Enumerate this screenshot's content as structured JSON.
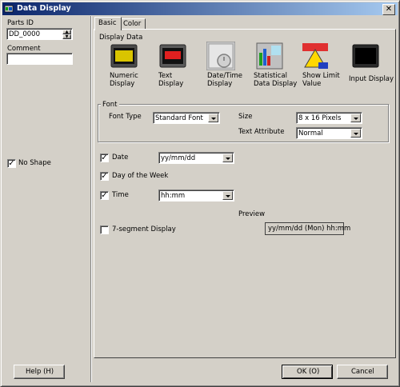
{
  "window": {
    "title": "Data Display",
    "close_glyph": "✕"
  },
  "left": {
    "parts_id_label": "Parts ID",
    "parts_id_value": "DD_0000",
    "comment_label": "Comment",
    "comment_value": "",
    "no_shape_label": "No Shape",
    "no_shape_checked": true
  },
  "tabs": [
    {
      "label": "Basic",
      "active": true
    },
    {
      "label": "Color",
      "active": false
    }
  ],
  "display_data": {
    "label": "Display Data",
    "options": [
      {
        "label_line1": "Numeric",
        "label_line2": "Display",
        "icon": "numeric-display-icon",
        "glyph": "123"
      },
      {
        "label_line1": "Text",
        "label_line2": "Display",
        "icon": "text-display-icon",
        "glyph": "abc"
      },
      {
        "label_line1": "Date/Time",
        "label_line2": "Display",
        "icon": "date-time-display-icon",
        "glyph": "1"
      },
      {
        "label_line1": "Statistical",
        "label_line2": "Data Display",
        "icon": "statistical-data-display-icon",
        "glyph": "%"
      },
      {
        "label_line1": "Show Limit",
        "label_line2": "Value",
        "icon": "show-limit-value-icon",
        "glyph": "max"
      },
      {
        "label_line1": "Input Display",
        "label_line2": "",
        "icon": "input-display-icon",
        "glyph": "123"
      }
    ]
  },
  "font": {
    "group_label": "Font",
    "font_type_label": "Font Type",
    "font_type_value": "Standard Font",
    "size_label": "Size",
    "size_value": "8 x 16 Pixels",
    "text_attribute_label": "Text Attribute",
    "text_attribute_value": "Normal"
  },
  "date": {
    "label": "Date",
    "checked": true,
    "format": "yy/mm/dd"
  },
  "day_of_week": {
    "label": "Day of the Week",
    "checked": true
  },
  "time": {
    "label": "Time",
    "checked": true,
    "format": "hh:mm"
  },
  "preview": {
    "label": "Preview",
    "value": "yy/mm/dd (Mon) hh:mm"
  },
  "seven_segment": {
    "label": "7-segment Display",
    "checked": false
  },
  "buttons": {
    "help": "Help (H)",
    "ok": "OK (O)",
    "cancel": "Cancel"
  },
  "colors": {
    "title_start": "#0a246a",
    "title_end": "#a6caf0",
    "face": "#d4d0c8"
  }
}
